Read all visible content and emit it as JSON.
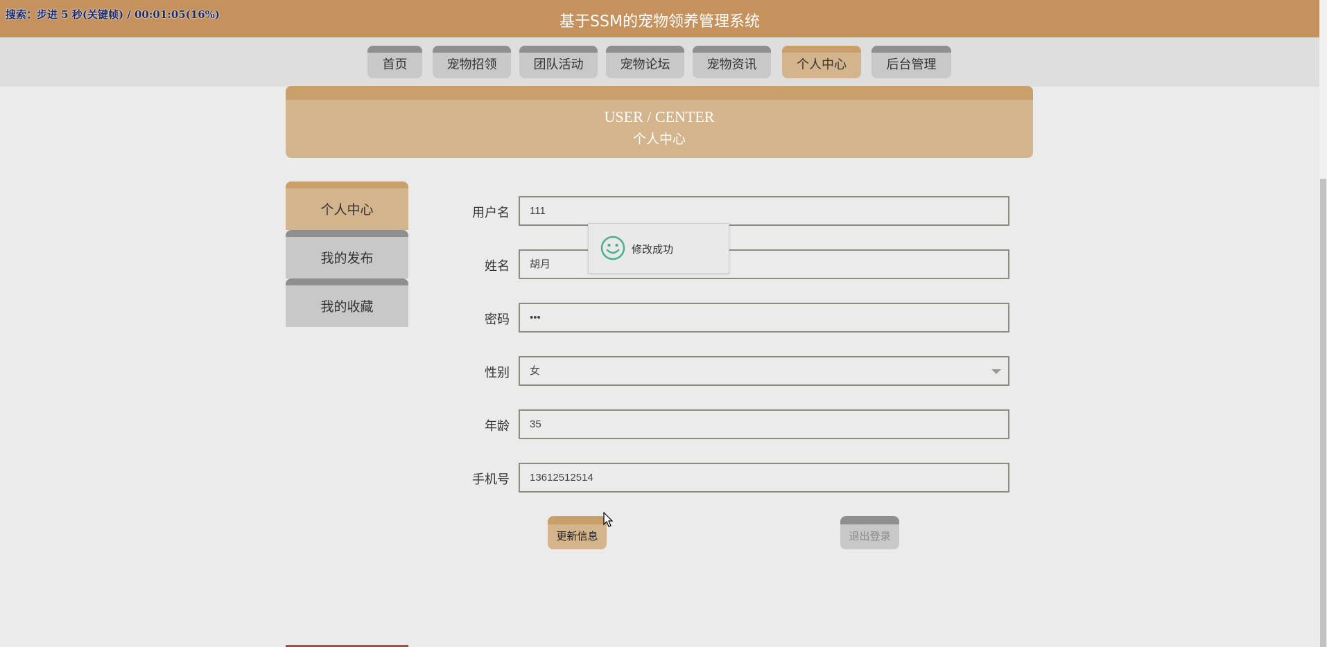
{
  "header": {
    "site_title": "基于SSM的宠物领养管理系统",
    "overlay": "搜索：步进 5 秒(关键帧) / 00:01:05(16%)"
  },
  "nav": {
    "items": [
      {
        "label": "首页",
        "active": false
      },
      {
        "label": "宠物招领",
        "active": false
      },
      {
        "label": "团队活动",
        "active": false
      },
      {
        "label": "宠物论坛",
        "active": false
      },
      {
        "label": "宠物资讯",
        "active": false
      },
      {
        "label": "个人中心",
        "active": true
      },
      {
        "label": "后台管理",
        "active": false
      }
    ]
  },
  "banner": {
    "english": "USER / CENTER",
    "chinese": "个人中心"
  },
  "sidebar": {
    "items": [
      {
        "label": "个人中心",
        "active": true
      },
      {
        "label": "我的发布",
        "active": false
      },
      {
        "label": "我的收藏",
        "active": false
      }
    ]
  },
  "form": {
    "username": {
      "label": "用户名",
      "value": "111"
    },
    "name": {
      "label": "姓名",
      "value": "胡月"
    },
    "password": {
      "label": "密码",
      "value": "•••"
    },
    "gender": {
      "label": "性别",
      "value": "女"
    },
    "age": {
      "label": "年龄",
      "value": "35"
    },
    "phone": {
      "label": "手机号",
      "value": "13612512514"
    }
  },
  "buttons": {
    "update": "更新信息",
    "logout": "退出登录"
  },
  "toast": {
    "message": "修改成功",
    "icon": "smiley-icon"
  },
  "colors": {
    "header": "#c5925d",
    "accent": "#d4b48c",
    "inactive": "#c8c8c8",
    "toast_icon": "#4caf8e"
  }
}
